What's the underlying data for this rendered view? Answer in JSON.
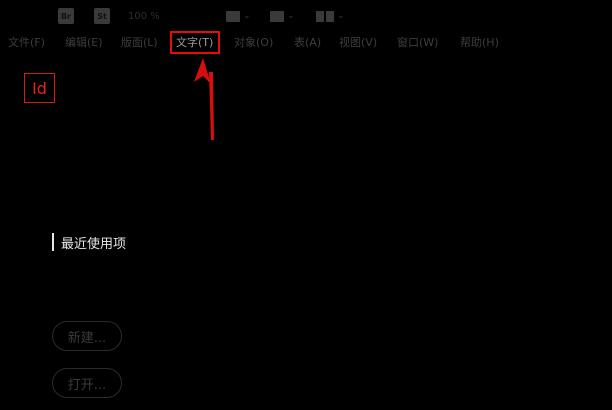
{
  "toolbar": {
    "br_badge": "Br",
    "st_badge": "St",
    "zoom": "100 %",
    "frame_caret": "⌄",
    "view_caret": "⌄",
    "layout_caret": "⌄"
  },
  "menu": {
    "items": [
      {
        "label": "文件(F)"
      },
      {
        "label": "编辑(E)"
      },
      {
        "label": "版面(L)"
      },
      {
        "label": "文字(T)"
      },
      {
        "label": "对象(O)"
      },
      {
        "label": "表(A)"
      },
      {
        "label": "视图(V)"
      },
      {
        "label": "窗口(W)"
      },
      {
        "label": "帮助(H)"
      }
    ],
    "highlighted_index": 3
  },
  "logo": {
    "text": "Id"
  },
  "start": {
    "recent_label": "最近使用项",
    "new_button": "新建...",
    "open_button": "打开..."
  },
  "colors": {
    "background": "#000000",
    "highlight": "#e10e0e",
    "logo": "#e2261a"
  }
}
